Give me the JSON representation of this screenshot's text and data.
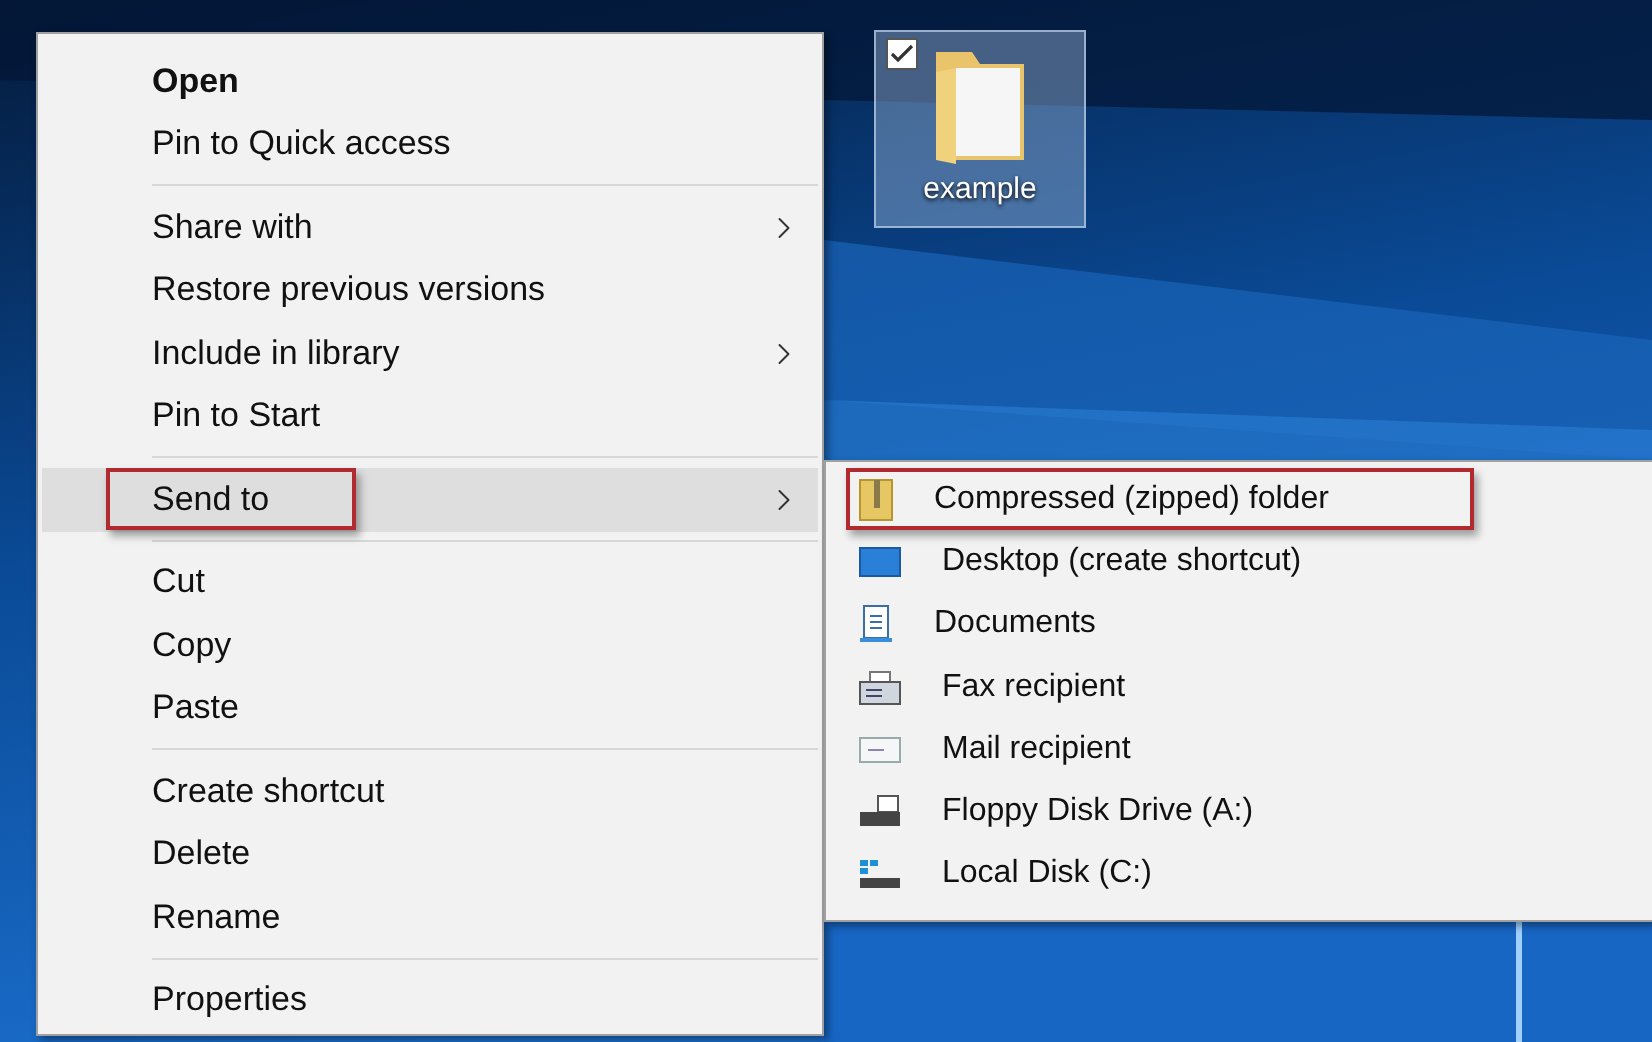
{
  "desktop": {
    "icons": [
      {
        "label": "example",
        "selected": true,
        "checked": true
      }
    ]
  },
  "context_menu": {
    "sections": [
      [
        {
          "label": "Open",
          "default": true,
          "submenu": false,
          "selected": false,
          "annotated": false
        },
        {
          "label": "Pin to Quick access",
          "default": false,
          "submenu": false,
          "selected": false,
          "annotated": false
        }
      ],
      [
        {
          "label": "Share with",
          "default": false,
          "submenu": true,
          "selected": false,
          "annotated": false
        },
        {
          "label": "Restore previous versions",
          "default": false,
          "submenu": false,
          "selected": false,
          "annotated": false
        },
        {
          "label": "Include in library",
          "default": false,
          "submenu": true,
          "selected": false,
          "annotated": false
        },
        {
          "label": "Pin to Start",
          "default": false,
          "submenu": false,
          "selected": false,
          "annotated": false
        }
      ],
      [
        {
          "label": "Send to",
          "default": false,
          "submenu": true,
          "selected": true,
          "annotated": true
        }
      ],
      [
        {
          "label": "Cut",
          "default": false,
          "submenu": false,
          "selected": false,
          "annotated": false
        },
        {
          "label": "Copy",
          "default": false,
          "submenu": false,
          "selected": false,
          "annotated": false
        },
        {
          "label": "Paste",
          "default": false,
          "submenu": false,
          "selected": false,
          "annotated": false
        }
      ],
      [
        {
          "label": "Create shortcut",
          "default": false,
          "submenu": false,
          "selected": false,
          "annotated": false
        },
        {
          "label": "Delete",
          "default": false,
          "submenu": false,
          "selected": false,
          "annotated": false
        },
        {
          "label": "Rename",
          "default": false,
          "submenu": false,
          "selected": false,
          "annotated": false
        }
      ],
      [
        {
          "label": "Properties",
          "default": false,
          "submenu": false,
          "selected": false,
          "annotated": false
        }
      ]
    ]
  },
  "send_to_menu": {
    "items": [
      {
        "label": "Compressed (zipped) folder",
        "kind": "zip",
        "annotated": true
      },
      {
        "label": "Desktop (create shortcut)",
        "kind": "desktop",
        "annotated": false
      },
      {
        "label": "Documents",
        "kind": "documents",
        "annotated": false
      },
      {
        "label": "Fax recipient",
        "kind": "fax",
        "annotated": false
      },
      {
        "label": "Mail recipient",
        "kind": "mail",
        "annotated": false
      },
      {
        "label": "Floppy Disk Drive (A:)",
        "kind": "floppy",
        "annotated": false
      },
      {
        "label": "Local Disk (C:)",
        "kind": "disk",
        "annotated": false
      }
    ]
  }
}
